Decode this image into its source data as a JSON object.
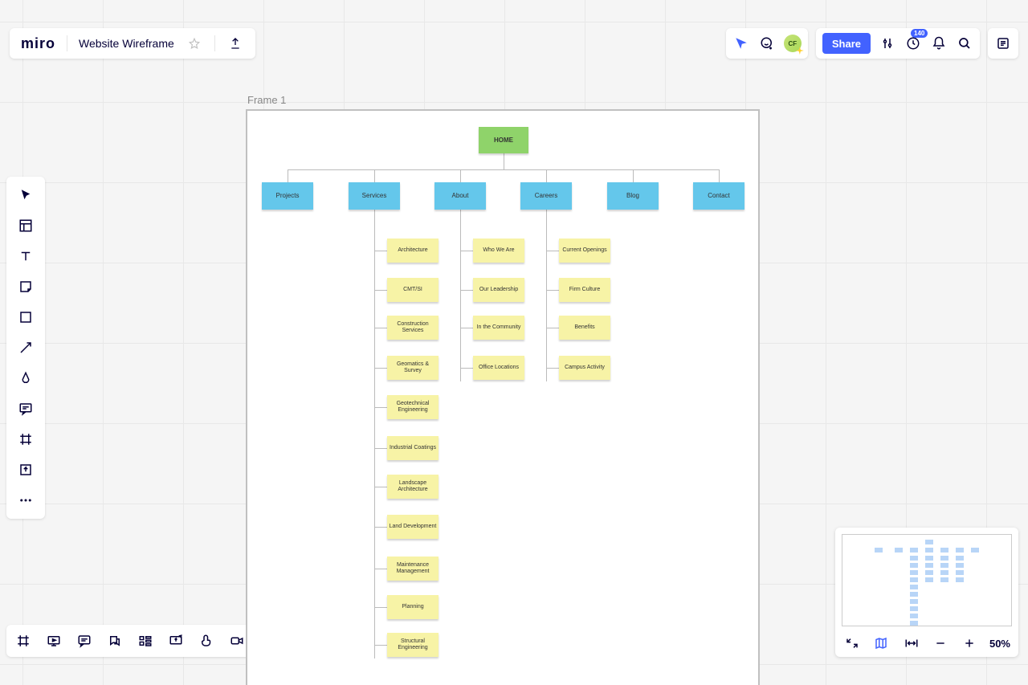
{
  "header": {
    "logo": "miro",
    "title": "Website Wireframe",
    "share_label": "Share"
  },
  "avatar": {
    "initials": "CF"
  },
  "notifications": {
    "count": "140"
  },
  "frame": {
    "label": "Frame 1"
  },
  "zoom": {
    "value": "50%"
  },
  "diagram": {
    "root": "HOME",
    "categories": [
      "Projects",
      "Services",
      "About",
      "Careers",
      "Blog",
      "Contact"
    ],
    "children": {
      "Services": [
        "Architecture",
        "CMT/SI",
        "Construction Services",
        "Geomatics & Survey",
        "Geotechnical Engineering",
        "Industrial Coatings",
        "Landscape Architecture",
        "Land Development",
        "Maintenance Management",
        "Planning",
        "Structural Engineering"
      ],
      "About": [
        "Who We Are",
        "Our Leadership",
        "In the Community",
        "Office Locations"
      ],
      "Careers": [
        "Current Openings",
        "Firm Culture",
        "Benefits",
        "Campus Activity"
      ]
    }
  }
}
